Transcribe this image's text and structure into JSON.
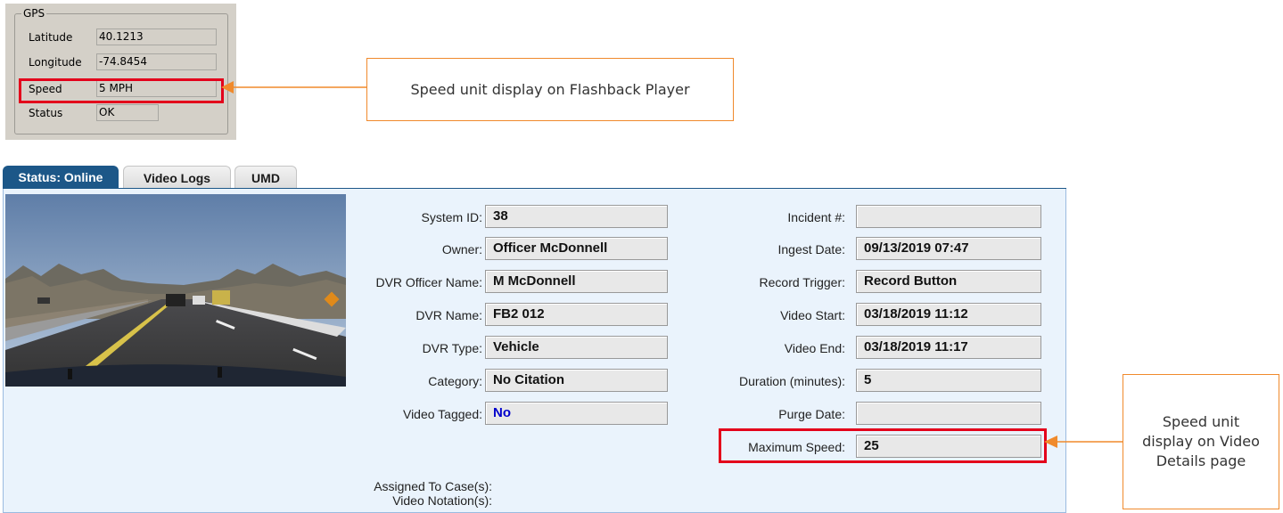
{
  "gps": {
    "title": "GPS",
    "rows": [
      {
        "label": "Latitude",
        "value": "40.1213"
      },
      {
        "label": "Longitude",
        "value": "-74.8454"
      },
      {
        "label": "Speed",
        "value": "5 MPH"
      },
      {
        "label": "Status",
        "value": "OK"
      }
    ]
  },
  "callouts": {
    "top": "Speed unit display on Flashback Player",
    "right": "Speed unit display on Video Details page"
  },
  "tabs": [
    {
      "label": "Status: Online",
      "active": true
    },
    {
      "label": "Video Logs",
      "active": false
    },
    {
      "label": "UMD",
      "active": false
    }
  ],
  "details": {
    "left": [
      {
        "label": "System ID:",
        "value": "38"
      },
      {
        "label": "Owner:",
        "value": "Officer McDonnell"
      },
      {
        "label": "DVR Officer Name:",
        "value": "M McDonnell"
      },
      {
        "label": "DVR Name:",
        "value": "FB2 012"
      },
      {
        "label": "DVR Type:",
        "value": "Vehicle"
      },
      {
        "label": "Category:",
        "value": "No Citation"
      },
      {
        "label": "Video Tagged:",
        "value": "No"
      }
    ],
    "right": [
      {
        "label": "Incident #:",
        "value": ""
      },
      {
        "label": "Ingest Date:",
        "value": "09/13/2019 07:47"
      },
      {
        "label": "Record Trigger:",
        "value": "Record Button"
      },
      {
        "label": "Video Start:",
        "value": "03/18/2019 11:12"
      },
      {
        "label": "Video End:",
        "value": "03/18/2019 11:17"
      },
      {
        "label": "Duration (minutes):",
        "value": "5"
      },
      {
        "label": "Purge Date:",
        "value": ""
      },
      {
        "label": "Maximum Speed:",
        "value": "25"
      }
    ],
    "assigned_label": "Assigned To Case(s):",
    "notation_label": "Video Notation(s):"
  },
  "colors": {
    "highlight": "#e3001b",
    "callout_border": "#f08a2c",
    "tab_active": "#1c5788",
    "panel_bg": "#eaf3fc"
  }
}
